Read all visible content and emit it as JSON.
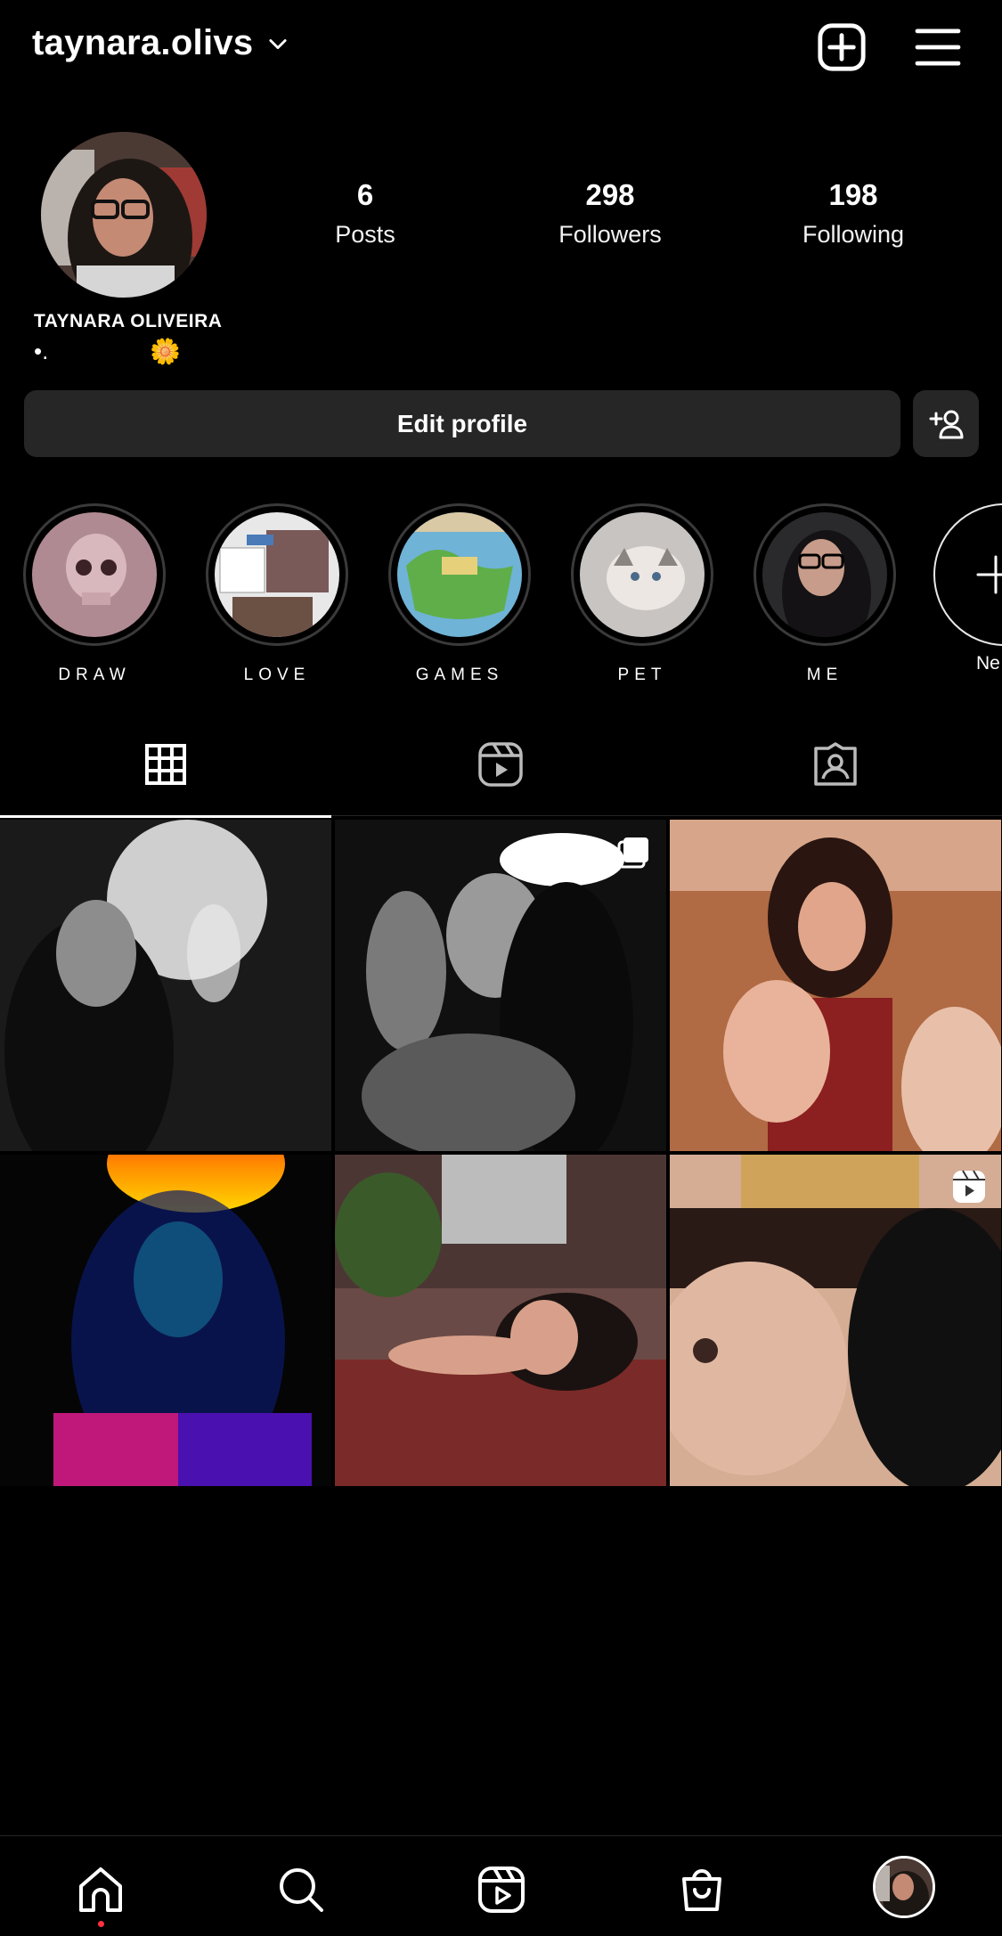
{
  "header": {
    "username": "taynara.olivs",
    "icons": [
      "chevron-down-icon",
      "new-post-icon",
      "menu-icon"
    ]
  },
  "profile": {
    "full_name": "TAYNARA OLIVEIRA",
    "bio_dot": "•.",
    "bio_emoji": "🌼",
    "stats": {
      "posts_count": "6",
      "posts_label": "Posts",
      "followers_count": "298",
      "followers_label": "Followers",
      "following_count": "198",
      "following_label": "Following"
    },
    "edit_profile_label": "Edit profile"
  },
  "highlights": [
    {
      "label": "DRAW"
    },
    {
      "label": "LOVE"
    },
    {
      "label": "GAMES"
    },
    {
      "label": "PET"
    },
    {
      "label": "ME"
    },
    {
      "label": "Ne"
    }
  ],
  "tabs": [
    "grid-icon",
    "reels-icon",
    "tagged-icon"
  ],
  "bottom_nav": [
    "home-icon",
    "search-icon",
    "reels-icon",
    "shop-icon",
    "profile-avatar"
  ],
  "colors": {
    "background": "#000000",
    "button": "#262626",
    "notification": "#ff3040"
  }
}
